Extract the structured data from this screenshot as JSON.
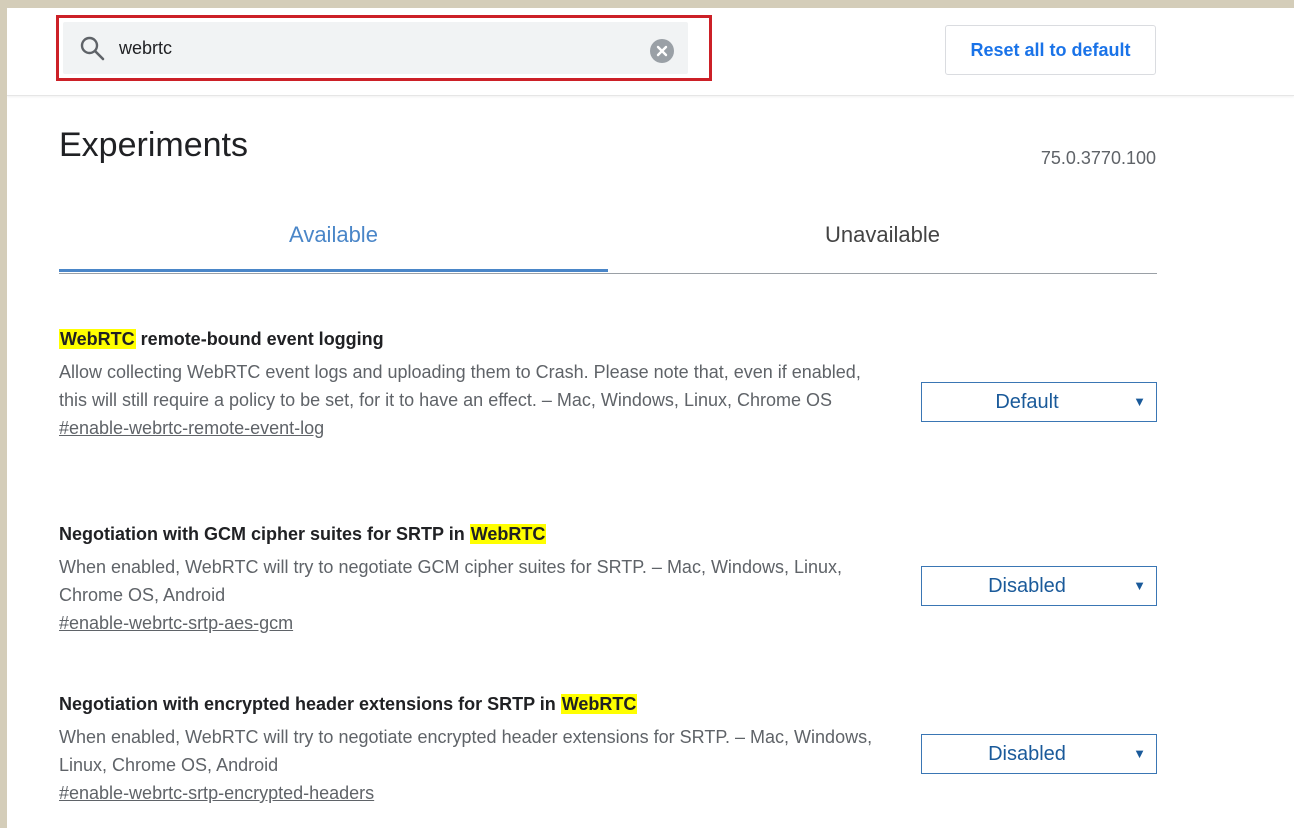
{
  "search": {
    "value": "webrtc",
    "icon": "search-icon",
    "clear_icon": "clear-icon",
    "highlight_color": "#cc2027"
  },
  "header": {
    "reset_label": "Reset all to default"
  },
  "page": {
    "title": "Experiments",
    "version": "75.0.3770.100"
  },
  "tabs": [
    {
      "label": "Available",
      "selected": true
    },
    {
      "label": "Unavailable",
      "selected": false
    }
  ],
  "experiments": [
    {
      "title_prefix": "",
      "title_highlight": "WebRTC",
      "title_suffix": " remote-bound event logging",
      "description": "Allow collecting WebRTC event logs and uploading them to Crash. Please note that, even if enabled, this will still require a policy to be set, for it to have an effect. – Mac, Windows, Linux, Chrome OS",
      "link": "#enable-webrtc-remote-event-log",
      "value": "Default"
    },
    {
      "title_prefix": "Negotiation with GCM cipher suites for SRTP in ",
      "title_highlight": "WebRTC",
      "title_suffix": "",
      "description": "When enabled, WebRTC will try to negotiate GCM cipher suites for SRTP. – Mac, Windows, Linux, Chrome OS, Android",
      "link": "#enable-webrtc-srtp-aes-gcm",
      "value": "Disabled"
    },
    {
      "title_prefix": "Negotiation with encrypted header extensions for SRTP in ",
      "title_highlight": "WebRTC",
      "title_suffix": "",
      "description": "When enabled, WebRTC will try to negotiate encrypted header extensions for SRTP. – Mac, Windows, Linux, Chrome OS, Android",
      "link": "#enable-webrtc-srtp-encrypted-headers",
      "value": "Disabled"
    }
  ],
  "colors": {
    "accent": "#4a86c8",
    "highlight": "#ffff00",
    "button_text": "#1a73e8"
  }
}
